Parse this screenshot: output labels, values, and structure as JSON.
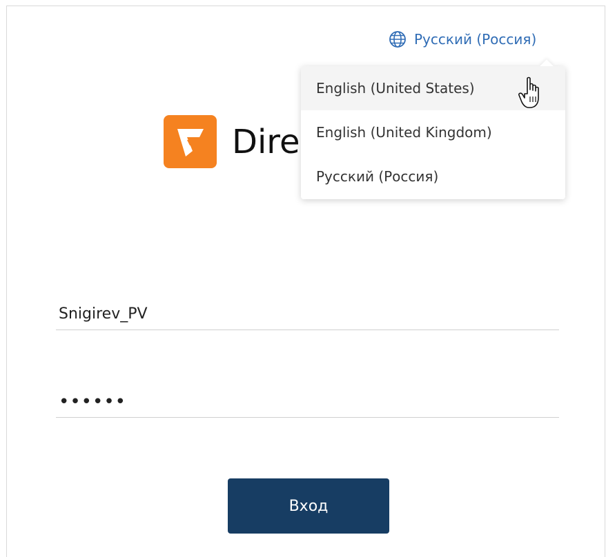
{
  "language_selector": {
    "current": "Русский (Россия)",
    "icon": "globe-icon",
    "options": [
      "English (United States)",
      "English (United Kingdom)",
      "Русский (Россия)"
    ]
  },
  "logo": {
    "text": "Dire",
    "icon": "directum-logo-icon",
    "color": "#f58220"
  },
  "login": {
    "username_value": "Snigirev_PV",
    "password_value": "••••••",
    "button_label": "Вход",
    "button_color": "#173d63"
  },
  "colors": {
    "link": "#2f6cb5"
  }
}
